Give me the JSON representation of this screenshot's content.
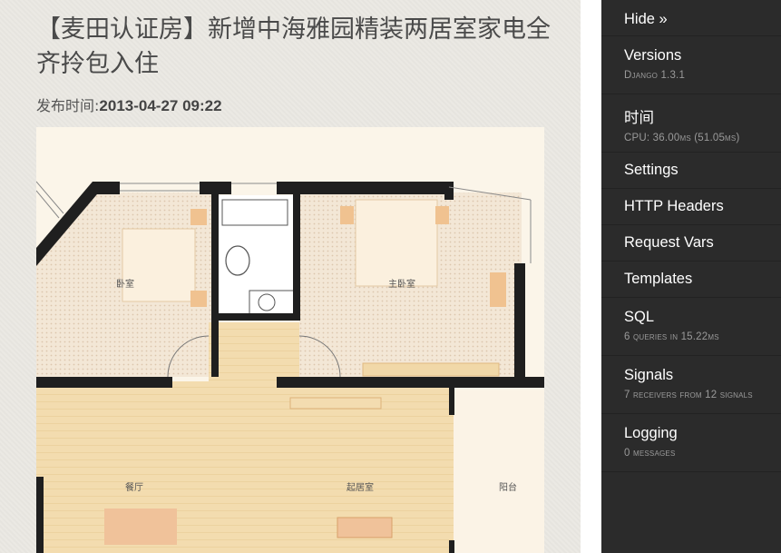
{
  "post": {
    "title": "【麦田认证房】新增中海雅园精装两居室家电全齐拎包入住",
    "date_label": "发布时间:",
    "date_value": "2013-04-27 09:22"
  },
  "floorplan": {
    "room_bedroom_2": "卧室",
    "room_master_bedroom": "主卧室",
    "room_dining": "餐厅",
    "room_living": "起居室",
    "room_balcony": "阳台"
  },
  "toolbar": {
    "hide_label": "Hide »",
    "items": [
      {
        "label": "Versions",
        "sub": "Django 1.3.1"
      },
      {
        "label": "时间",
        "sub": "CPU: 36.00ms (51.05ms)"
      },
      {
        "label": "Settings"
      },
      {
        "label": "HTTP Headers"
      },
      {
        "label": "Request Vars"
      },
      {
        "label": "Templates"
      },
      {
        "label": "SQL",
        "sub": "6 queries in 15.22ms"
      },
      {
        "label": "Signals",
        "sub": "7 receivers from 12 signals"
      },
      {
        "label": "Logging",
        "sub": "0 messages"
      }
    ]
  }
}
